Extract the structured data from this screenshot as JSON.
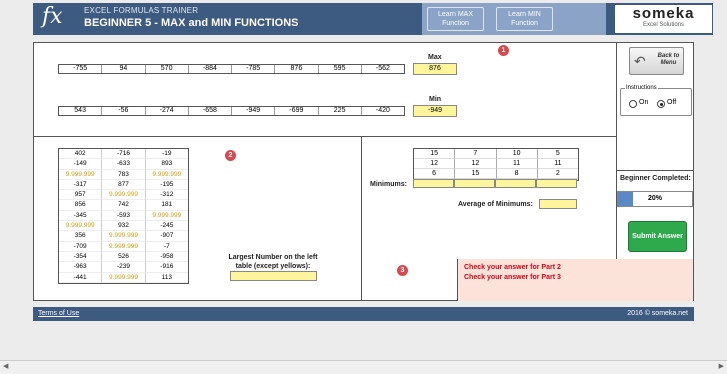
{
  "header": {
    "fx_symbol": "fx",
    "subtitle": "EXCEL FORMULAS TRAINER",
    "title": "BEGINNER 5 - MAX and MIN FUNCTIONS",
    "learn_max": "Learn MAX Function",
    "learn_min": "Learn MIN Function",
    "logo_main": "someka",
    "logo_sub": "Excel Solutions"
  },
  "part1": {
    "badge": "1",
    "max_label": "Max",
    "min_label": "Min",
    "row_max": [
      "-755",
      "94",
      "570",
      "-884",
      "-785",
      "876",
      "595",
      "-562"
    ],
    "max_answer": "876",
    "row_min": [
      "543",
      "-56",
      "-274",
      "-658",
      "-949",
      "-699",
      "225",
      "-420"
    ],
    "min_answer": "-949"
  },
  "part2": {
    "badge": "2",
    "table": [
      [
        "402",
        "-716",
        "-19"
      ],
      [
        "-149",
        "-633",
        "893"
      ],
      [
        "9.999.999",
        "783",
        "9.999.999"
      ],
      [
        "-317",
        "877",
        "-195"
      ],
      [
        "957",
        "9.999.999",
        "-312"
      ],
      [
        "856",
        "742",
        "181"
      ],
      [
        "-345",
        "-593",
        "9.999.999"
      ],
      [
        "9.999.999",
        "932",
        "-245"
      ],
      [
        "356",
        "9.999.999",
        "-907"
      ],
      [
        "-709",
        "9.999.999",
        "-7"
      ],
      [
        "-354",
        "526",
        "-958"
      ],
      [
        "-963",
        "-239",
        "-916"
      ],
      [
        "-441",
        "9.999.999",
        "113"
      ]
    ],
    "largest_label_1": "Largest Number on the left",
    "largest_label_2": "table (except yellows):"
  },
  "part3": {
    "badge": "3",
    "grid": [
      [
        "15",
        "7",
        "10",
        "5"
      ],
      [
        "12",
        "12",
        "11",
        "11"
      ],
      [
        "6",
        "15",
        "8",
        "2"
      ]
    ],
    "minimums_label": "Minimums:",
    "average_label": "Average of Minimums:"
  },
  "feedback": {
    "line1": "Check your answer for Part 2",
    "line2": "Check your answer for Part 3"
  },
  "sidebar": {
    "back_label": "Back to Menu",
    "instructions_label": "Instructions",
    "on_label": "On",
    "off_label": "Off",
    "instructions_selected": "Off",
    "completed_label": "Beginner Completed:",
    "completed_pct_text": "20%",
    "completed_fraction": 0.2,
    "submit_label": "Submit Answer"
  },
  "footer": {
    "terms": "Terms of Use",
    "copyright": "2016 © someka.net"
  },
  "colors": {
    "header_bg": "#3d5a80",
    "yellow_cell": "#fff59d",
    "gold_text": "#d4a017",
    "badge_red": "#d9484f",
    "submit_green": "#2eaa4c",
    "feedback_red": "#d0021b"
  }
}
